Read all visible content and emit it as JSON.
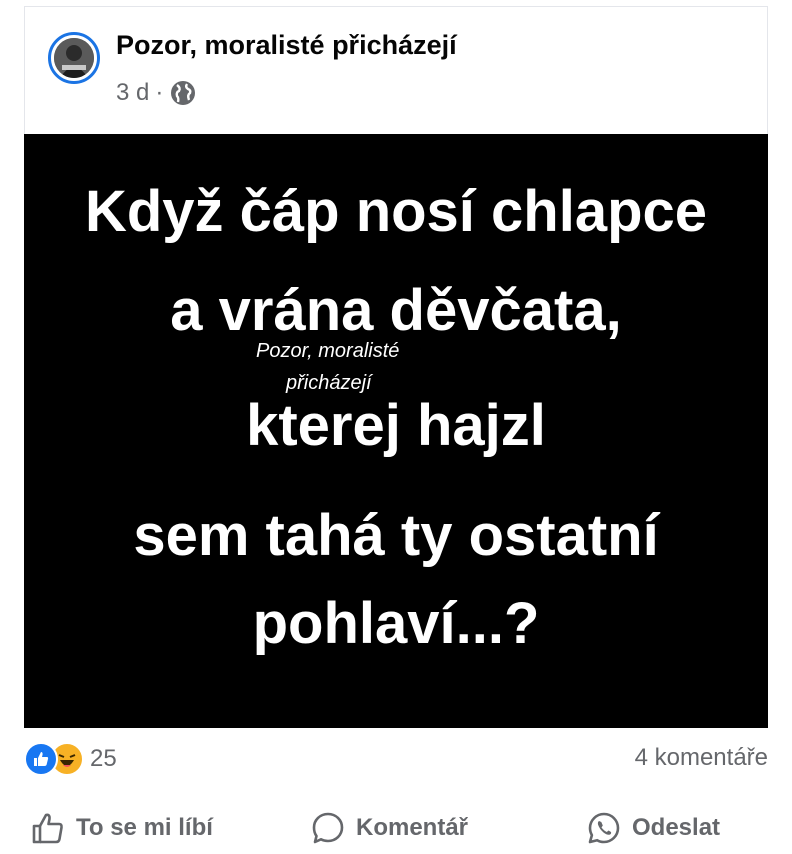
{
  "post": {
    "page_name": "Pozor, moralisté přicházejí",
    "time": "3 d",
    "separator": "·",
    "privacy_icon": "globe-icon",
    "avatar_icon": "page-avatar"
  },
  "image": {
    "lines": [
      "Když čáp nosí chlapce",
      "a vrána děvčata,",
      "kterej hajzl",
      "sem tahá ty ostatní",
      "pohlaví...?"
    ],
    "watermark_line1": "Pozor, moralisté",
    "watermark_line2": "přicházejí"
  },
  "stats": {
    "reaction_icons": [
      "like-icon",
      "haha-icon"
    ],
    "reaction_count": "25",
    "comments": "4 komentáře"
  },
  "actions": {
    "like_label": "To se mi líbí",
    "comment_label": "Komentář",
    "share_label": "Odeslat"
  },
  "colors": {
    "accent": "#1b74e4",
    "like": "#1877f2",
    "haha": "#f7b125",
    "secondary_text": "#65676b",
    "primary_text": "#050505",
    "image_bg": "#000000"
  }
}
